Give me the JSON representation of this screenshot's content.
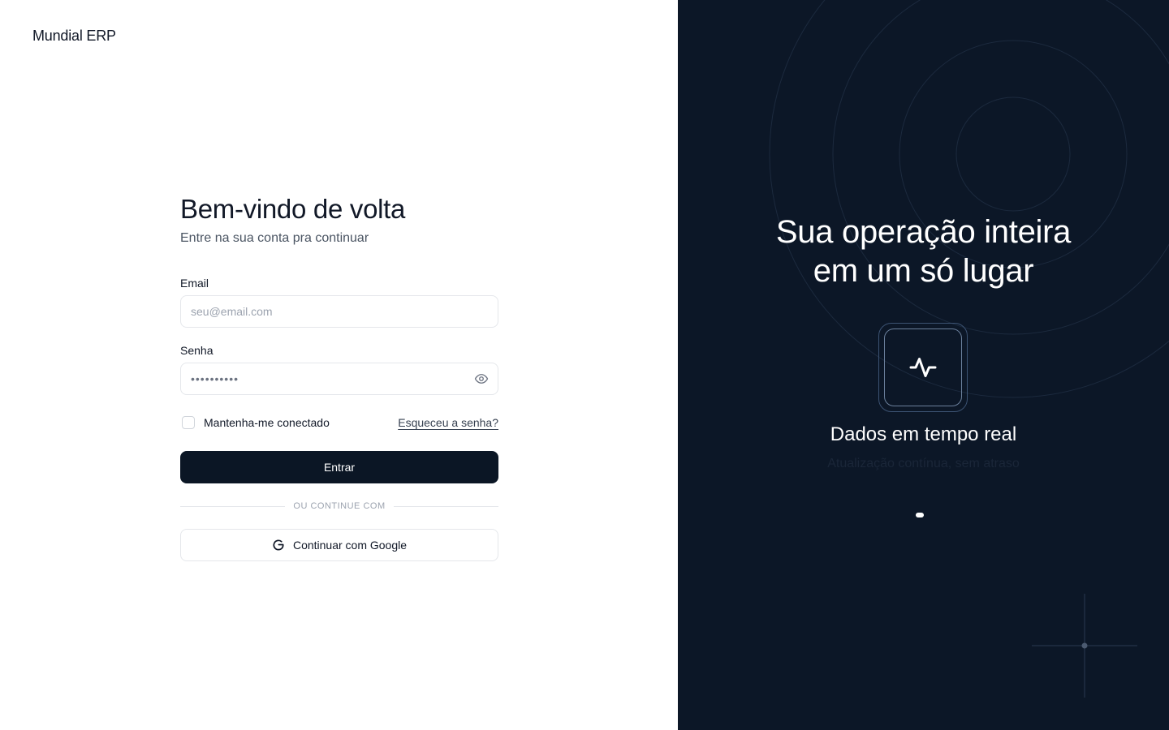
{
  "brand": {
    "name": "Mundial ERP"
  },
  "login": {
    "title": "Bem-vindo de volta",
    "subtitle": "Entre na sua conta pra continuar",
    "email_label": "Email",
    "email_placeholder": "seu@email.com",
    "password_label": "Senha",
    "password_value": "••••••••••",
    "remember_label": "Mantenha-me conectado",
    "forgot_link": "Esqueceu a senha?",
    "submit_label": "Entrar",
    "divider_text": "OU CONTINUE COM",
    "google_label": "Continuar com Google"
  },
  "hero": {
    "headline_line1": "Sua operação inteira",
    "headline_line2": "em um só lugar",
    "feature_icon": "activity-pulse-icon",
    "feature_title": "Dados em tempo real",
    "feature_desc": "Atualização contínua, sem atraso",
    "carousel_active_index": 0
  },
  "colors": {
    "primary_dark": "#0b1625",
    "hero_bg": "#0c1727",
    "border": "#e5e7eb"
  }
}
